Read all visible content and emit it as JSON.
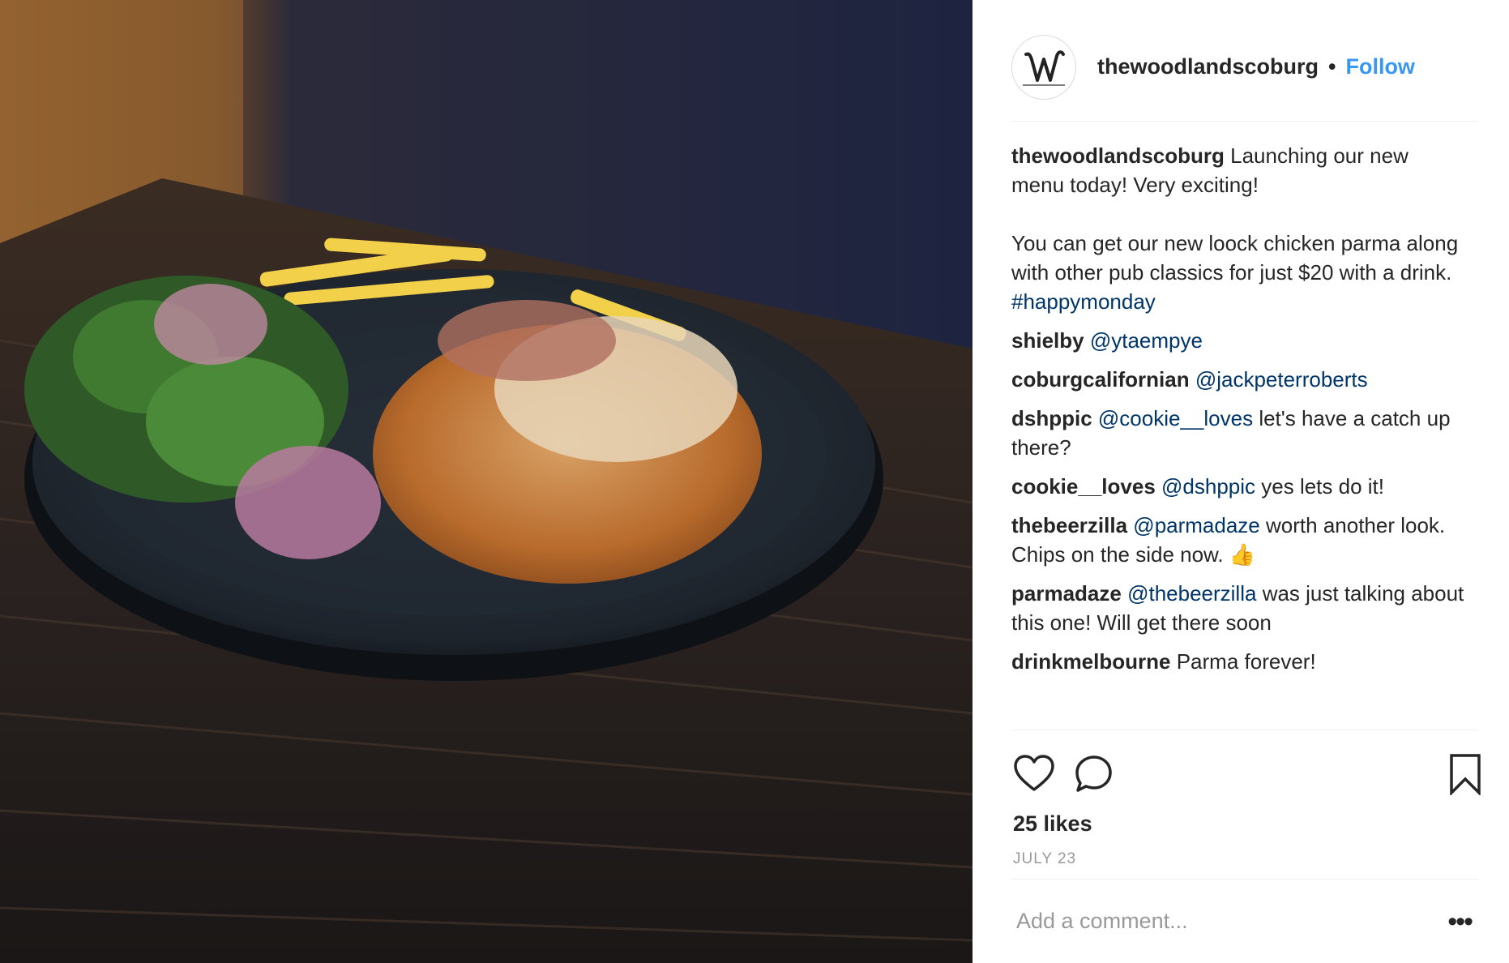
{
  "post": {
    "username": "thewoodlandscoburg",
    "follow_label": "Follow",
    "separator": "•",
    "avatar_icon": "woodlands-w-logo",
    "caption": {
      "author": "thewoodlandscoburg",
      "line1": "Launching our new menu today! Very exciting!",
      "line2": "You can get our new loock chicken parma along with other pub classics for just $20 with a drink.",
      "hashtag": "#happymonday"
    },
    "comments": [
      {
        "author": "shielby",
        "mention": "@ytaempye",
        "text": ""
      },
      {
        "author": "coburgcalifornian",
        "mention": "@jackpeterroberts",
        "text": ""
      },
      {
        "author": "dshppic",
        "mention": "@cookie__loves",
        "text": "let's have a catch up there?"
      },
      {
        "author": "cookie__loves",
        "mention": "@dshppic",
        "text": "yes lets do it!"
      },
      {
        "author": "thebeerzilla",
        "mention": "@parmadaze",
        "text": "worth another look. Chips on the side now. 👍"
      },
      {
        "author": "parmadaze",
        "mention": "@thebeerzilla",
        "text": "was just talking about this one! Will get there soon"
      },
      {
        "author": "drinkmelbourne",
        "mention": "",
        "text": "Parma forever!"
      }
    ],
    "likes": "25 likes",
    "date": "JULY 23",
    "comment_placeholder": "Add a comment...",
    "more_label": "•••",
    "colors": {
      "link": "#003569",
      "follow": "#3897f0",
      "muted": "#999999"
    }
  }
}
